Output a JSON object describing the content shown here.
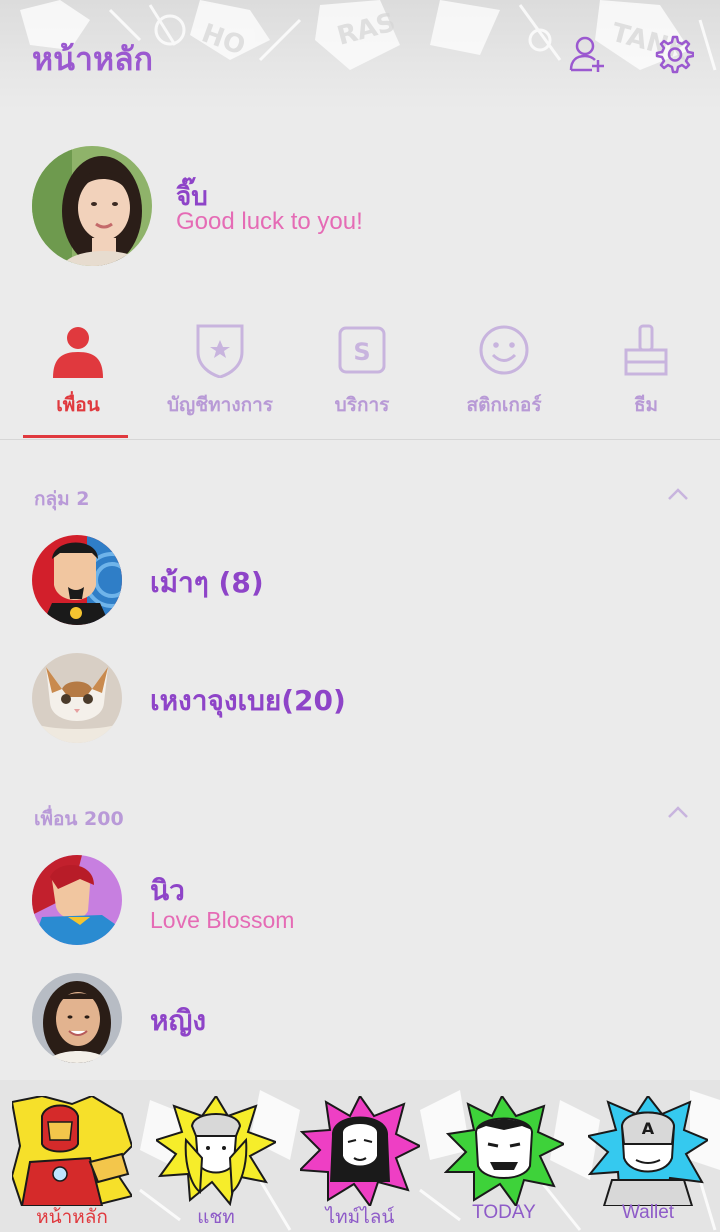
{
  "header": {
    "title": "หน้าหลัก",
    "icons": [
      "add-friend-icon",
      "settings-icon"
    ]
  },
  "profile": {
    "name": "จิ๊บ",
    "status": "Good luck to you!"
  },
  "tabs": [
    {
      "label": "เพื่อน",
      "icon": "person-icon",
      "active": true
    },
    {
      "label": "บัญชีทางการ",
      "icon": "official-badge-icon",
      "active": false
    },
    {
      "label": "บริการ",
      "icon": "services-icon",
      "active": false
    },
    {
      "label": "สติกเกอร์",
      "icon": "smiley-icon",
      "active": false
    },
    {
      "label": "ธีม",
      "icon": "theme-brush-icon",
      "active": false
    }
  ],
  "groups": {
    "header": "กลุ่ม 2",
    "items": [
      {
        "name": "เม้าๆ (8)"
      },
      {
        "name": "เหงาจุงเบย(20)"
      }
    ]
  },
  "friends": {
    "header": "เพื่อน 200",
    "items": [
      {
        "name": "นิว",
        "status": "Love Blossom"
      },
      {
        "name": "หญิง"
      }
    ]
  },
  "bottom_nav": [
    {
      "label": "หน้าหลัก",
      "icon": "home-iron-man-icon",
      "active": true
    },
    {
      "label": "แชท",
      "icon": "chat-thor-icon",
      "active": false
    },
    {
      "label": "ไทม์ไลน์",
      "icon": "timeline-black-widow-icon",
      "active": false
    },
    {
      "label": "TODAY",
      "icon": "today-hulk-icon",
      "active": false
    },
    {
      "label": "Wallet",
      "icon": "wallet-captain-america-icon",
      "active": false
    }
  ],
  "colors": {
    "accent": "#9b59d0",
    "active": "#e0393e",
    "status": "#e56bb5",
    "background": "#ebebeb"
  }
}
